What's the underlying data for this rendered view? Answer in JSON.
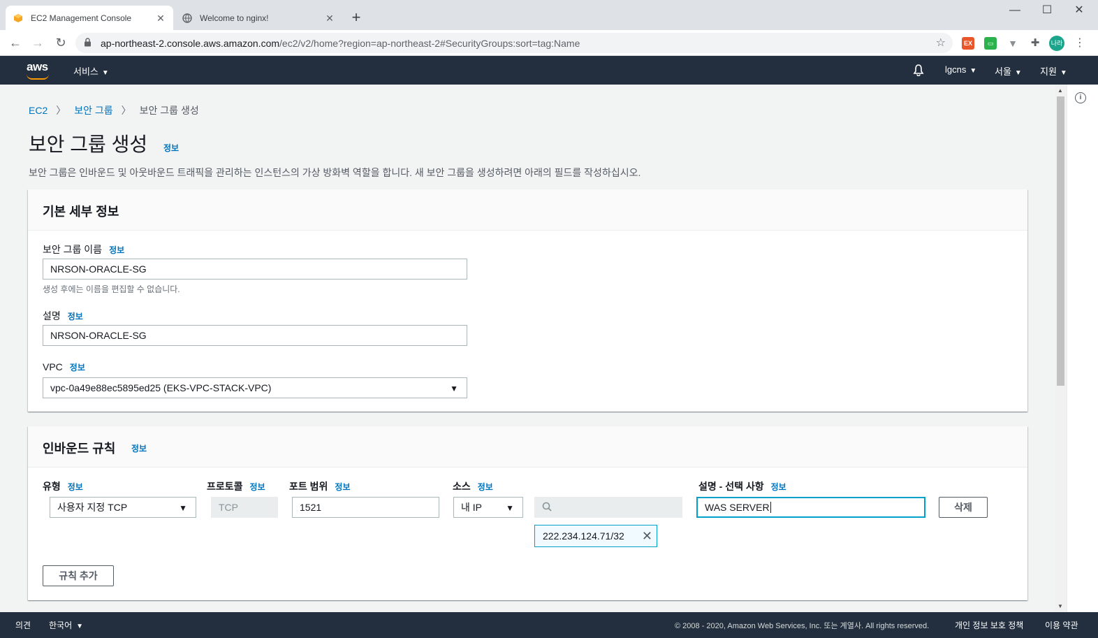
{
  "browser": {
    "tabs": [
      {
        "title": "EC2 Management Console",
        "active": true
      },
      {
        "title": "Welcome to nginx!",
        "active": false
      }
    ],
    "url_host": "ap-northeast-2.console.aws.amazon.com",
    "url_path": "/ec2/v2/home?region=ap-northeast-2#SecurityGroups:sort=tag:Name",
    "avatar_label": "나라",
    "ext_label": "EX"
  },
  "aws_nav": {
    "logo": "aws",
    "services": "서비스",
    "account": "lgcns",
    "region": "서울",
    "support": "지원"
  },
  "breadcrumb": {
    "root": "EC2",
    "parent": "보안 그룹",
    "current": "보안 그룹 생성"
  },
  "page": {
    "title": "보안 그룹 생성",
    "info": "정보",
    "description": "보안 그룹은 인바운드 및 아웃바운드 트래픽을 관리하는 인스턴스의 가상 방화벽 역할을 합니다. 새 보안 그룹을 생성하려면 아래의 필드를 작성하십시오."
  },
  "basic": {
    "header": "기본 세부 정보",
    "name_label": "보안 그룹 이름",
    "name_value": "NRSON-ORACLE-SG",
    "name_hint": "생성 후에는 이름을 편집할 수 없습니다.",
    "desc_label": "설명",
    "desc_value": "NRSON-ORACLE-SG",
    "vpc_label": "VPC",
    "vpc_value": "vpc-0a49e88ec5895ed25 (EKS-VPC-STACK-VPC)"
  },
  "inbound": {
    "header": "인바운드 규칙",
    "type_label": "유형",
    "protocol_label": "프로토콜",
    "port_label": "포트 범위",
    "source_label": "소스",
    "desc_label": "설명 - 선택 사항",
    "type_value": "사용자 지정 TCP",
    "protocol_value": "TCP",
    "port_value": "1521",
    "source_value": "내 IP",
    "search_placeholder": "",
    "cidr_token": "222.234.124.71/32",
    "desc_value": "WAS SERVER",
    "delete_label": "삭제",
    "add_rule_label": "규칙 추가"
  },
  "footer": {
    "feedback": "의견",
    "language": "한국어",
    "copyright": "© 2008 - 2020, Amazon Web Services, Inc. 또는 계열사. All rights reserved.",
    "privacy": "개인 정보 보호 정책",
    "terms": "이용 약관"
  },
  "colors": {
    "link": "#0073bb",
    "nav_bg": "#232f3e",
    "focus": "#00a1c9",
    "aws_orange": "#ff9900"
  }
}
